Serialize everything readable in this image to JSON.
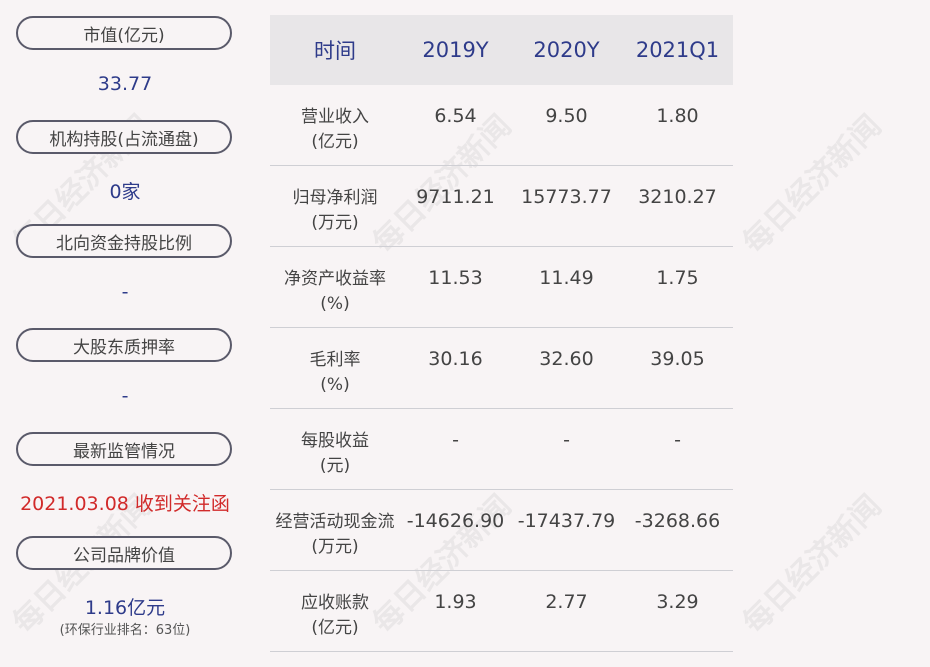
{
  "sidebar": {
    "items": [
      {
        "label": "市值(亿元)",
        "value": "33.77"
      },
      {
        "label": "机构持股(占流通盘)",
        "value": "0家"
      },
      {
        "label": "北向资金持股比例",
        "value": "-"
      },
      {
        "label": "大股东质押率",
        "value": "-"
      },
      {
        "label": "最新监管情况",
        "value": "2021.03.08 收到关注函"
      },
      {
        "label": "公司品牌价值",
        "value": "1.16亿元",
        "note": "(环保行业排名：63位)"
      }
    ]
  },
  "table": {
    "headers": [
      "时间",
      "2019Y",
      "2020Y",
      "2021Q1"
    ],
    "rows": [
      {
        "metric": "营业收入",
        "unit": "(亿元)",
        "values": [
          "6.54",
          "9.50",
          "1.80"
        ]
      },
      {
        "metric": "归母净利润",
        "unit": "(万元)",
        "values": [
          "9711.21",
          "15773.77",
          "3210.27"
        ]
      },
      {
        "metric": "净资产收益率",
        "unit": "(%)",
        "values": [
          "11.53",
          "11.49",
          "1.75"
        ]
      },
      {
        "metric": "毛利率",
        "unit": "(%)",
        "values": [
          "30.16",
          "32.60",
          "39.05"
        ]
      },
      {
        "metric": "每股收益",
        "unit": "(元)",
        "values": [
          "-",
          "-",
          "-"
        ]
      },
      {
        "metric": "经营活动现金流",
        "unit": "(万元)",
        "values": [
          "-14626.90",
          "-17437.79",
          "-3268.66"
        ]
      },
      {
        "metric": "应收账款",
        "unit": "(亿元)",
        "values": [
          "1.93",
          "2.77",
          "3.29"
        ]
      }
    ]
  },
  "watermark": "每日经济新闻",
  "colors": {
    "accent": "#2e3b8a",
    "alert": "#d12a2a",
    "header_bg": "#e8e6e8",
    "page_bg": "#f8f4f5"
  }
}
